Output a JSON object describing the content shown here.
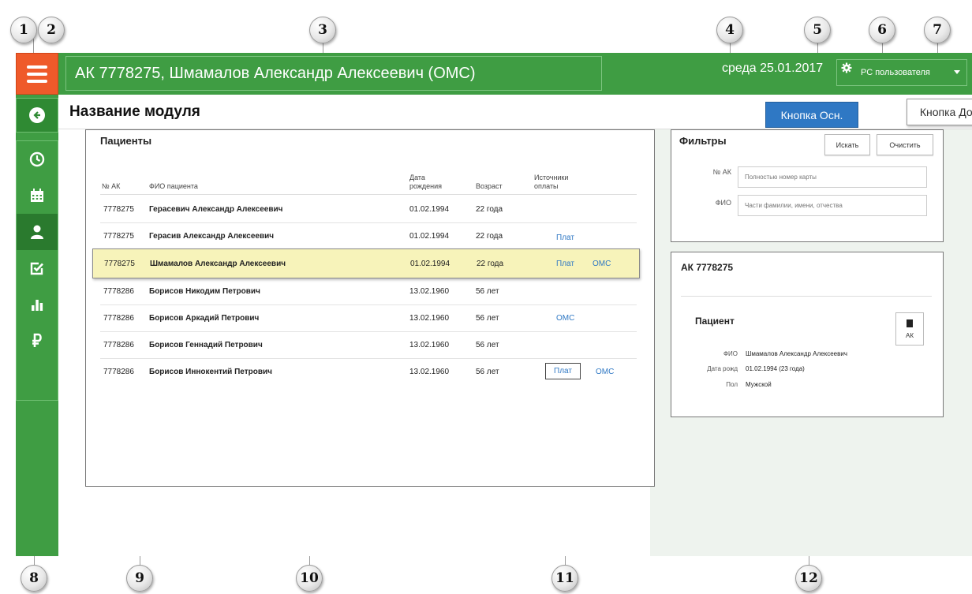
{
  "markers": [
    "1",
    "2",
    "3",
    "4",
    "5",
    "6",
    "7",
    "8",
    "9",
    "10",
    "11",
    "12"
  ],
  "topbar": {
    "patient_title": "АК 7778275, Шмамалов Александр Алексеевич (ОМС)",
    "date": "среда 25.01.2017",
    "role": "РС пользователя"
  },
  "module": {
    "title": "Название модуля",
    "primary_button": "Кнопка Осн.",
    "secondary_button": "Кнопка Доп."
  },
  "patients": {
    "title": "Пациенты",
    "columns": [
      "№ АК",
      "ФИО пациента",
      "Дата рождения",
      "Возраст",
      "Источники оплаты"
    ],
    "rows": [
      {
        "ak": "7778275",
        "name": "Герасевич Александр Алексеевич",
        "dob": "01.02.1994",
        "age": "22 года",
        "pay1": "",
        "pay2": ""
      },
      {
        "ak": "7778275",
        "name": "Герасив Александр Алексеевич",
        "dob": "01.02.1994",
        "age": "22 года",
        "pay1": "Плат",
        "pay2": ""
      },
      {
        "ak": "7778275",
        "name": "Шмамалов Александр Алексеевич",
        "dob": "01.02.1994",
        "age": "22 года",
        "pay1": "Плат",
        "pay2": "ОМС"
      },
      {
        "ak": "7778286",
        "name": "Борисов Никодим Петрович",
        "dob": "13.02.1960",
        "age": "56 лет",
        "pay1": "",
        "pay2": ""
      },
      {
        "ak": "7778286",
        "name": "Борисов Аркадий Петрович",
        "dob": "13.02.1960",
        "age": "56 лет",
        "pay1": "ОМС",
        "pay2": ""
      },
      {
        "ak": "7778286",
        "name": "Борисов Геннадий Петрович",
        "dob": "13.02.1960",
        "age": "56 лет",
        "pay1": "",
        "pay2": ""
      },
      {
        "ak": "7778286",
        "name": "Борисов Иннокентий Петрович",
        "dob": "13.02.1960",
        "age": "56 лет",
        "pay1": "Плат",
        "pay2": "ОМС"
      }
    ]
  },
  "filters": {
    "title": "Фильтры",
    "search_button": "Искать",
    "clear_button": "Очистить",
    "ak_label": "№ АК",
    "ak_placeholder": "Полностью номер карты",
    "fio_label": "ФИО",
    "fio_placeholder": "Части фамилии, имени, отчества"
  },
  "card": {
    "title": "АК 7778275",
    "subtitle": "Пациент",
    "ak_button": "АК",
    "fio_label": "ФИО",
    "fio_value": "Шмамалов Александр Алексеевич",
    "dob_label": "Дата рожд",
    "dob_value": "01.02.1994 (23 года)",
    "sex_label": "Пол",
    "sex_value": "Мужской"
  },
  "colors": {
    "green": "#3f9d43",
    "orange": "#ef5a2a",
    "blue": "#2f78c4",
    "selected_row": "#f7f3ba"
  },
  "icons": [
    "menu-icon",
    "back-arrow-icon",
    "clock-icon",
    "calendar-icon",
    "user-icon",
    "checkbox-icon",
    "bar-chart-icon",
    "ruble-icon",
    "gear-icon",
    "chevron-down-icon",
    "card-icon"
  ]
}
